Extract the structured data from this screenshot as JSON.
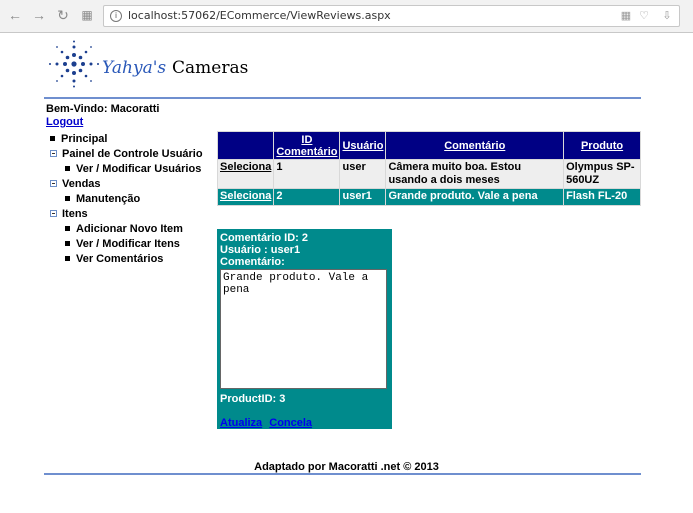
{
  "browser": {
    "url": "localhost:57062/ECommerce/ViewReviews.aspx"
  },
  "logo": {
    "text_a": "Yahya's",
    "text_b": "Cameras"
  },
  "header": {
    "welcome": "Bem-Vindo: Macoratti",
    "logout": "Logout"
  },
  "menu": [
    {
      "label": "Principal",
      "level": 0,
      "type": "leaf"
    },
    {
      "label": "Painel de Controle Usuário",
      "level": 0,
      "type": "group"
    },
    {
      "label": "Ver / Modificar Usuários",
      "level": 1,
      "type": "leaf"
    },
    {
      "label": "Vendas",
      "level": 0,
      "type": "group"
    },
    {
      "label": "Manutenção",
      "level": 1,
      "type": "leaf"
    },
    {
      "label": "Itens",
      "level": 0,
      "type": "group"
    },
    {
      "label": "Adicionar Novo Item",
      "level": 1,
      "type": "leaf"
    },
    {
      "label": "Ver / Modificar Itens",
      "level": 1,
      "type": "leaf"
    },
    {
      "label": "Ver Comentários",
      "level": 1,
      "type": "leaf"
    }
  ],
  "grid": {
    "headers": [
      "",
      "ID Comentário",
      "Usuário",
      "Comentário",
      "Produto"
    ],
    "rows": [
      {
        "select": "Seleciona",
        "id": "1",
        "user": "user",
        "comment": "Câmera muito boa. Estou usando a dois meses",
        "product": "Olympus SP-560UZ"
      },
      {
        "select": "Seleciona",
        "id": "2",
        "user": "user1",
        "comment": "Grande produto. Vale a pena",
        "product": "Flash FL-20"
      }
    ]
  },
  "details": {
    "comment_id": "Comentário ID: 2",
    "user": "Usuário : user1",
    "comment_label": "Comentário:",
    "comment_value": "Grande produto. Vale a pena",
    "product_id": "ProductID: 3",
    "update": "Atualiza",
    "cancel": "Concela"
  },
  "footer": "Adaptado por Macoratti .net © 2013"
}
